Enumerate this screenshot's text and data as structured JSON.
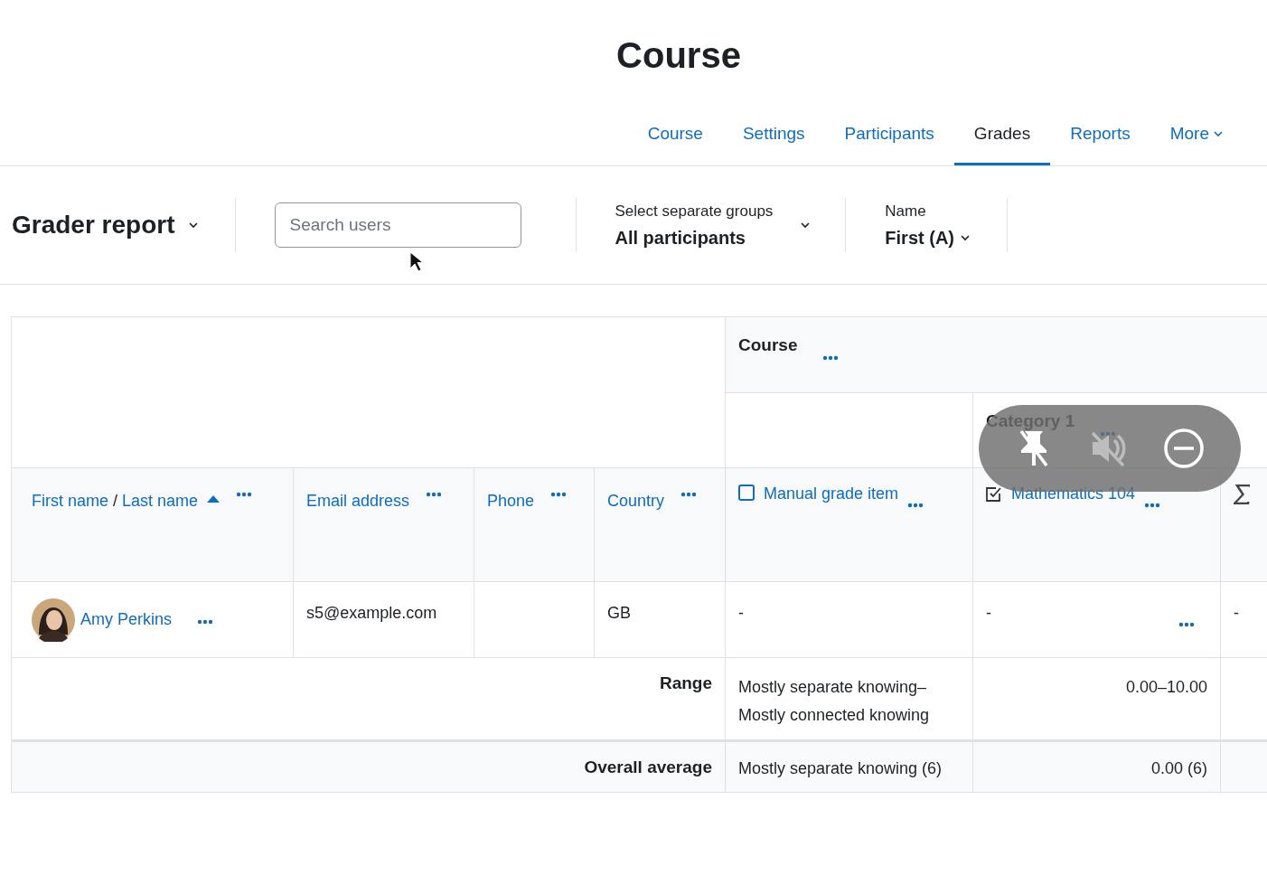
{
  "page_title": "Course",
  "nav_tabs": [
    {
      "label": "Course",
      "selected": false,
      "kind": "link"
    },
    {
      "label": "Settings",
      "selected": false,
      "kind": "link"
    },
    {
      "label": "Participants",
      "selected": false,
      "kind": "link"
    },
    {
      "label": "Grades",
      "selected": true,
      "kind": "link"
    },
    {
      "label": "Reports",
      "selected": false,
      "kind": "link"
    },
    {
      "label": "More",
      "selected": false,
      "kind": "menu"
    }
  ],
  "report_selector": {
    "title": "Grader report"
  },
  "search": {
    "placeholder": "Search users"
  },
  "group_filter": {
    "label": "Select separate groups",
    "value": "All participants"
  },
  "name_filter": {
    "label": "Name",
    "value": "First (A)"
  },
  "table": {
    "course_header": "Course",
    "category_header": "Category 1",
    "columns": [
      {
        "kind": "name",
        "first": "First name",
        "separator": "/",
        "last": "Last name",
        "sorted_ascending": true
      },
      {
        "kind": "field",
        "label": "Email address"
      },
      {
        "kind": "field",
        "label": "Phone"
      },
      {
        "kind": "field",
        "label": "Country"
      },
      {
        "kind": "manual",
        "label": "Manual grade item"
      },
      {
        "kind": "module",
        "label": "Mathematics 104"
      },
      {
        "kind": "total"
      }
    ],
    "rows": [
      {
        "name": "Amy Perkins",
        "email": "s5@example.com",
        "country": "GB",
        "grades": [
          {
            "value": "-",
            "kind": "plain"
          },
          {
            "value": "-",
            "kind": "with_menu"
          },
          {
            "value": "-",
            "kind": "plain"
          }
        ]
      }
    ],
    "summary_rows": [
      {
        "label": "Range",
        "values": [
          "Mostly separate knowing– Mostly connected knowing",
          "0.00–10.00"
        ]
      },
      {
        "label": "Overall average",
        "values": [
          "Mostly separate knowing (6)",
          "0.00 (6)"
        ]
      }
    ]
  },
  "media_controls": [
    {
      "kind": "unpin",
      "disabled": false
    },
    {
      "kind": "unmute",
      "disabled": true
    },
    {
      "kind": "remove",
      "disabled": false
    }
  ]
}
